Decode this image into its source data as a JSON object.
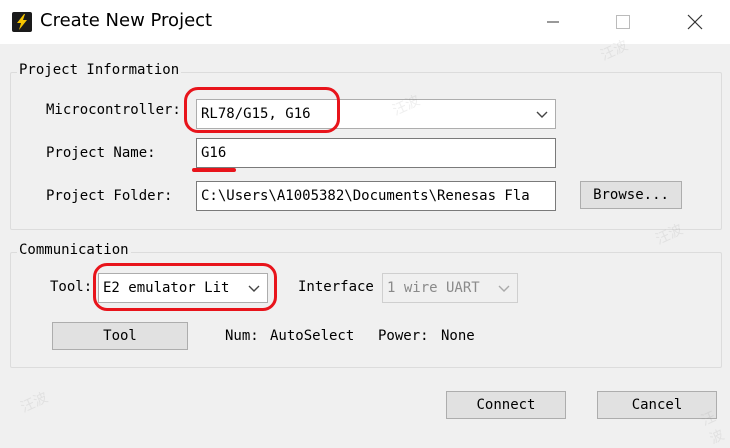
{
  "window": {
    "title": "Create New Project",
    "controls": {
      "minimize": "–",
      "maximize": "☐",
      "close": "✕"
    }
  },
  "project_information": {
    "legend": "Project Information",
    "microcontroller": {
      "label": "Microcontroller:",
      "value": "RL78/G15, G16"
    },
    "project_name": {
      "label": "Project Name:",
      "value": "G16"
    },
    "project_folder": {
      "label": "Project Folder:",
      "value": "C:\\Users\\A1005382\\Documents\\Renesas Fla",
      "browse_label": "Browse..."
    }
  },
  "communication": {
    "legend": "Communication",
    "tool": {
      "label": "Tool:",
      "value": "E2 emulator Lit"
    },
    "interface": {
      "label": "Interface",
      "value": "1 wire UART"
    },
    "tool_button_label": "Tool",
    "num_label": "Num:",
    "num_value": "AutoSelect",
    "power_label": "Power:",
    "power_value": "None"
  },
  "buttons": {
    "connect": "Connect",
    "cancel": "Cancel"
  },
  "annotation_color": "#e8141b",
  "watermark_text": "汪波"
}
